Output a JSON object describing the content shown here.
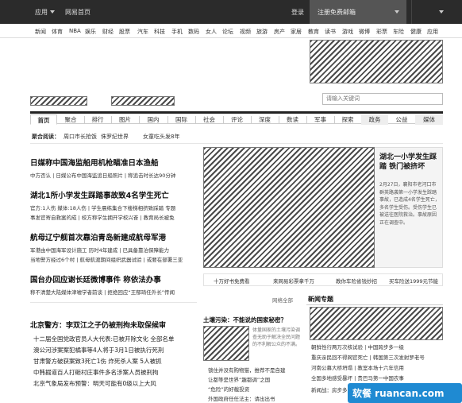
{
  "topbar": {
    "app_label": "应用",
    "home_label": "网易首页",
    "login_label": "登录",
    "register_label": "注册免费邮箱"
  },
  "channels": [
    "新闻",
    "体育",
    "NBA",
    "娱乐",
    "财经",
    "股票",
    "汽车",
    "科技",
    "手机",
    "数码",
    "女人",
    "论坛",
    "视频",
    "旅游",
    "房产",
    "家居",
    "教育",
    "读书",
    "游戏",
    "微博",
    "彩票",
    "车险",
    "健康",
    "应用"
  ],
  "search": {
    "placeholder": "请输入关键词"
  },
  "tabs": [
    "首页",
    "聚合",
    "排行",
    "图片",
    "国内",
    "国际",
    "社会",
    "评论",
    "深度",
    "数读",
    "军事",
    "探索",
    "政务",
    "公益",
    "媒体"
  ],
  "active_tab": "首页",
  "subline": {
    "label": "聚合阅读：",
    "items": [
      "周口市长抢饭",
      "侏罗纪世界",
      "女童吃头发8年"
    ]
  },
  "main_news": [
    {
      "title": "日媒称中国海监船用机枪瞄准日本渔船",
      "sub": "中方否认 | 日媒公布中国海监追日船照片 | 称追击时长达90分钟"
    },
    {
      "title": "湖北1所小学发生踩踏事故致4名学生死亡",
      "sub": "官方:1人伤  媒体:18人伤 | 学生晨练集合下楼梯相挤致踩踏 专题",
      "sub3": "事发官寄自救案的成 | 校方称学生拥开学校兴奋 | 教育局长被免"
    },
    {
      "title": "航母辽宁舰首次靠泊青岛新建成航母军港",
      "sub": "军港由中国海军设计施工 历时4年建成 | 已具备靠泊保障能力",
      "sub3": "当地警方经过6个村 | 航母航渡期间组织武器试验 | 或要在部署三亚"
    },
    {
      "title": "国台办回应谢长廷微博事件 称依法办事",
      "sub": "称不清楚大陆媒体津嘘学者前谈 | 拒绝回应“王郁琦任外长”传闻"
    },
    {
      "title": "北京警方：李双江之子仍被刑拘未取保候审",
      "list": [
        "十二届全国党政官员人大代表:已被开除文化 全部名单",
        "澳公河涉案案犯橘事等4人将于3月1日被执行死刑",
        "甘肃警方破获案致3死亡1伤 炸死杀人案 5人被抓",
        "中韩掘道百人打砸村庄事件多名涉案人员被刑拘",
        "北京气象局发布预警：明天可能有0级以上大风"
      ]
    }
  ],
  "feature": {
    "title": "湖北一小学发生踩踏 铁门被挤坏",
    "desc": "2月27日，襄阳市老河口市群英路袭第一小学发生踩踏事故，已造成4名学生死亡，多名学生受伤。受伤学生已被送往医院救治。事故原因正在调查中。"
  },
  "promo_links": [
    "十万好书免费看",
    "来网易彩票拿千万",
    "教你车险省钱妙招",
    "买车险送1999元节能"
  ],
  "mid_labels": {
    "ad": "网络全部",
    "special": "新闻专题"
  },
  "mid_story": {
    "title": "土壤污染：不能说的国家秘密？",
    "desc": "体量国家的土壤污染调查无助于解决全民问题的不利解公众的不满。",
    "links": [
      "锁住并没有购物猫，推荐不是自建",
      "让都等是世界“趣都调”之国",
      "“危险”的好截投资",
      "外国政府任任法主：请出出书"
    ]
  },
  "special_links": [
    "朝鲜性行两万次核试验 | 中国跨步多一级",
    "重庆亲民回不得网官死亡 | 韩国第三次发射罗老号",
    "河南公募大桥坍塌 | 教室本场十六年信用",
    "全国多地感受暴坏 | 贵巴马第一中国农事",
    "新闻战：房步多乐"
  ],
  "watermark": "软餐 ruancan.com"
}
